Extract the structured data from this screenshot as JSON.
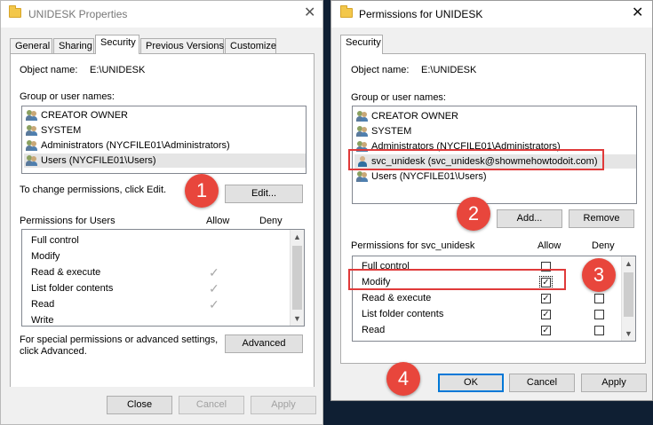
{
  "left_dialog": {
    "title": "UNIDESK Properties",
    "tabs": [
      "General",
      "Sharing",
      "Security",
      "Previous Versions",
      "Customize"
    ],
    "object_name_label": "Object name:",
    "object_name_value": "E:\\UNIDESK",
    "group_label": "Group or user names:",
    "users": [
      "CREATOR OWNER",
      "SYSTEM",
      "Administrators (NYCFILE01\\Administrators)",
      "Users (NYCFILE01\\Users)"
    ],
    "change_text": "To change permissions, click Edit.",
    "edit_button": "Edit...",
    "permissions_header": "Permissions for Users",
    "allow_header": "Allow",
    "deny_header": "Deny",
    "permissions": [
      "Full control",
      "Modify",
      "Read & execute",
      "List folder contents",
      "Read",
      "Write"
    ],
    "special_text_1": "For special permissions or advanced settings,",
    "special_text_2": "click Advanced.",
    "advanced_button": "Advanced",
    "close_button": "Close",
    "cancel_button": "Cancel",
    "apply_button": "Apply"
  },
  "right_dialog": {
    "title": "Permissions for UNIDESK",
    "tab": "Security",
    "object_name_label": "Object name:",
    "object_name_value": "E:\\UNIDESK",
    "group_label": "Group or user names:",
    "users": [
      "CREATOR OWNER",
      "SYSTEM",
      "Administrators (NYCFILE01\\Administrators)",
      "svc_unidesk (svc_unidesk@showmehowtodoit.com)",
      "Users (NYCFILE01\\Users)"
    ],
    "add_button": "Add...",
    "remove_button": "Remove",
    "permissions_header": "Permissions for svc_unidesk",
    "allow_header": "Allow",
    "deny_header": "Deny",
    "permissions": [
      "Full control",
      "Modify",
      "Read & execute",
      "List folder contents",
      "Read"
    ],
    "ok_button": "OK",
    "cancel_button": "Cancel",
    "apply_button": "Apply"
  },
  "callouts": [
    "1",
    "2",
    "3",
    "4"
  ],
  "colors": {
    "accent": "#0078d7",
    "annotation_red": "#e03a3a",
    "callout_red": "#e8463c",
    "desktop": "#0f1f33"
  }
}
